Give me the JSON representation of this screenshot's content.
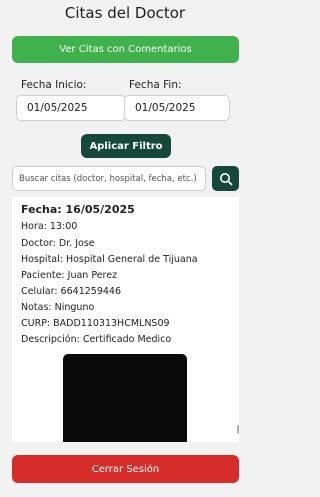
{
  "header": {
    "title": "Citas del Doctor"
  },
  "actions": {
    "view_comments_label": "Ver Citas con Comentarios",
    "apply_filter_label": "Aplicar Filtro",
    "logout_label": "Cerrar Sesión"
  },
  "filters": {
    "start_label": "Fecha Inicio:",
    "start_value": "01/05/2025",
    "end_label": "Fecha Fin:",
    "end_value": "01/05/2025"
  },
  "search": {
    "placeholder": "Buscar citas (doctor, hospital, fecha, etc.)",
    "icon": "search-icon"
  },
  "appointment": {
    "date_line": "Fecha: 16/05/2025",
    "hora": "Hora: 13:00",
    "doctor": "Doctor: Dr. Jose",
    "hospital": "Hospital: Hospital General de Tijuana",
    "paciente": "Paciente: Juan Perez",
    "celular": "Celular: 6641259446",
    "notas": "Notas: Ninguno",
    "curp": "CURP: BADD110313HCMLNS09",
    "descripcion": "Descripción: Certificado Medico"
  },
  "colors": {
    "green_button": "#3fb14d",
    "dark_button": "#16483a",
    "red_button": "#d62c2a"
  }
}
